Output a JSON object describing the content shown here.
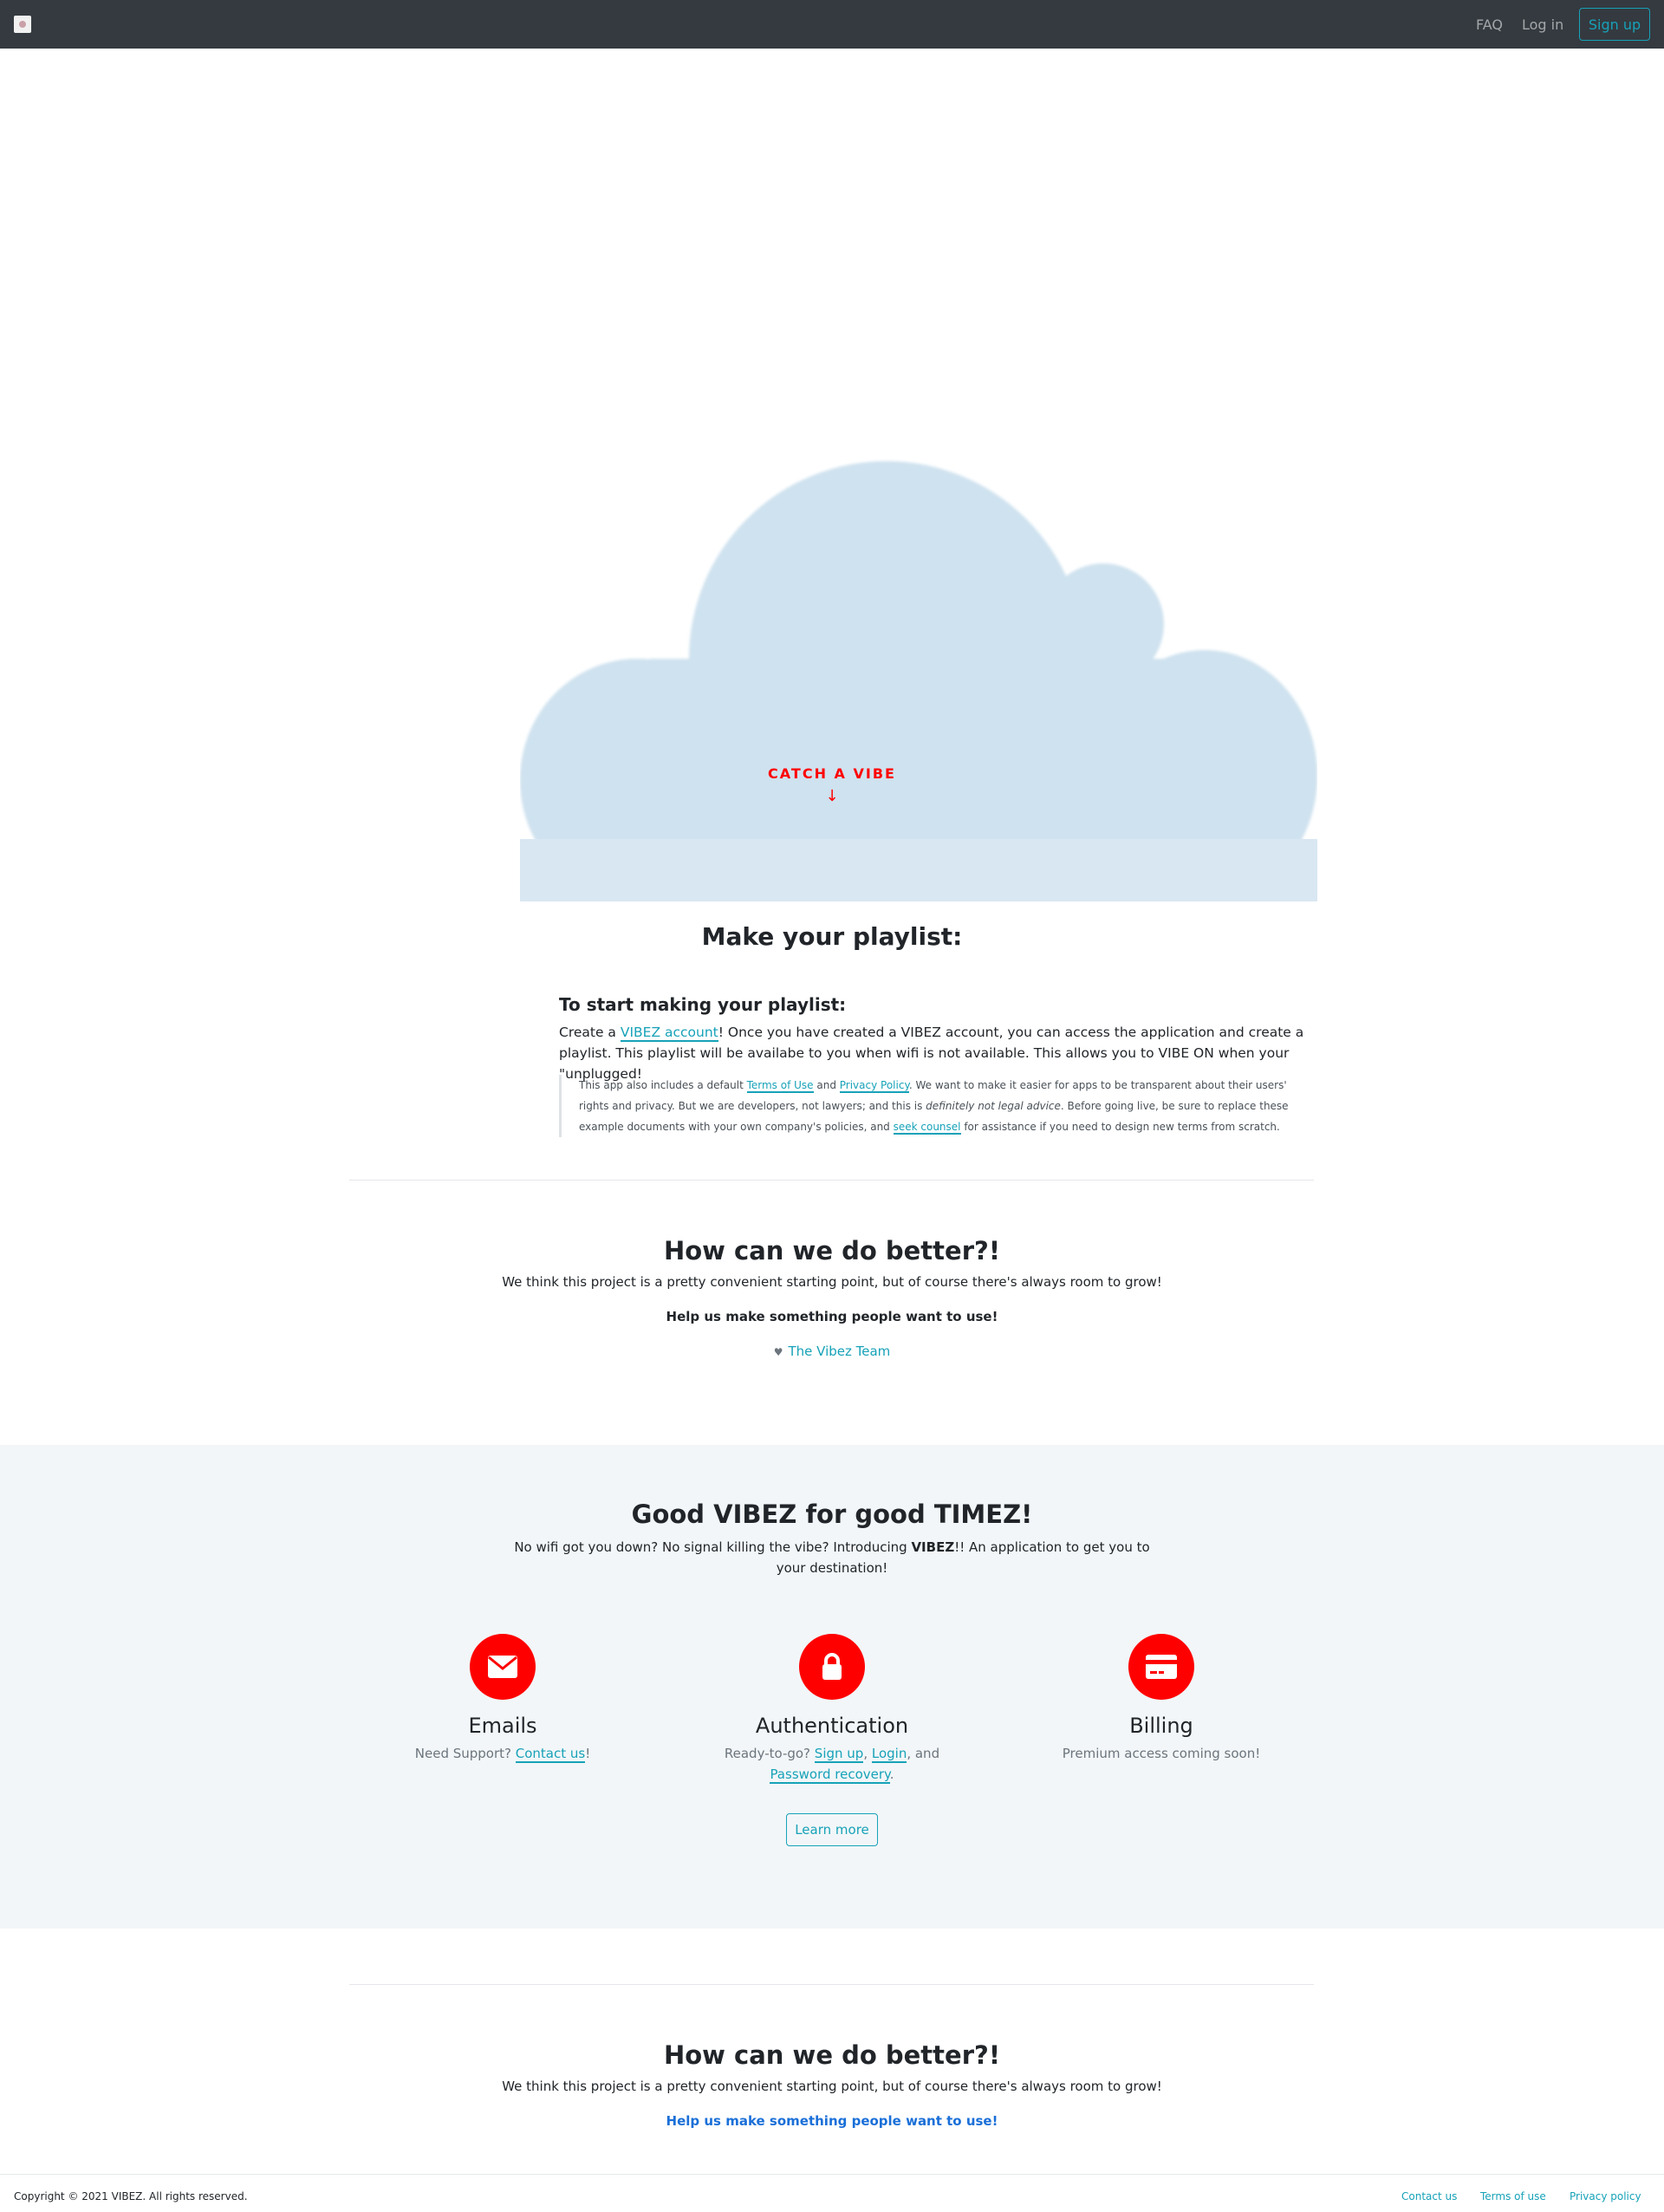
{
  "navbar": {
    "logo_icon": "app-logo-icon",
    "faq": "FAQ",
    "login": "Log in",
    "signup": "Sign up"
  },
  "hero": {
    "cta": "CATCH A VIBE",
    "arrow": "↓",
    "cloud_color": "#cfe2ef"
  },
  "playlist": {
    "title": "Make your playlist:",
    "heading": "To start making your playlist:",
    "body_prefix": "Create a ",
    "account_link": "VIBEZ account",
    "body_suffix": "! Once you have created a VIBEZ account, you can access the application and create a playlist. This playlist will be availabe to you when wifi is not available. This allows you to VIBE ON when your \"unplugged!",
    "note": {
      "p1": "This app also includes a default ",
      "terms": "Terms of Use",
      "p2": " and ",
      "privacy": "Privacy Policy",
      "p3": ". We want to make it easier for apps to be transparent about their users' rights and privacy. But we are developers, not lawyers; and this is ",
      "italic": "definitely not legal advice",
      "p4": ". Before going live, be sure to replace these example documents with your own company's policies, and ",
      "counsel": "seek counsel",
      "p5": " for assistance if you need to design new terms from scratch."
    }
  },
  "feedback1": {
    "title": "How can we do better?!",
    "body": "We think this project is a pretty convenient starting point, but of course there's always room to grow!",
    "strong": "Help us make something people want to use!",
    "heart": "♥",
    "team": "The Vibez Team"
  },
  "features": {
    "title_p1": "Good ",
    "title_b1": "VIBEZ",
    "title_p2": " for good ",
    "title_b2": "TIMEZ",
    "title_p3": "!",
    "sub_p1": "No wifi got you down? No signal killing the vibe? Introducing ",
    "sub_b": "VIBEZ",
    "sub_p2": "!! An application to get you to your destination!",
    "accent": "#ff0000",
    "items": [
      {
        "icon": "envelope-icon",
        "name": "Emails",
        "text_p1": "Need Support? ",
        "link": "Contact us",
        "text_p2": "!"
      },
      {
        "icon": "lock-icon",
        "name": "Authentication",
        "text_p1": "Ready-to-go? ",
        "link1": "Sign up",
        "sep1": ", ",
        "link2": "Login",
        "sep2": ", and ",
        "link3": "Password recovery",
        "end": "."
      },
      {
        "icon": "credit-card-icon",
        "name": "Billing",
        "text": "Premium access coming soon!"
      }
    ],
    "learn_more": "Learn more"
  },
  "feedback2": {
    "title": "How can we do better?!",
    "body": "We think this project is a pretty convenient starting point, but of course there's always room to grow!",
    "strong": "Help us make something people want to use!"
  },
  "footer": {
    "copyright": "Copyright © 2021 VIBEZ. All rights reserved.",
    "links": [
      "Contact us",
      "Terms of use",
      "Privacy policy"
    ]
  }
}
